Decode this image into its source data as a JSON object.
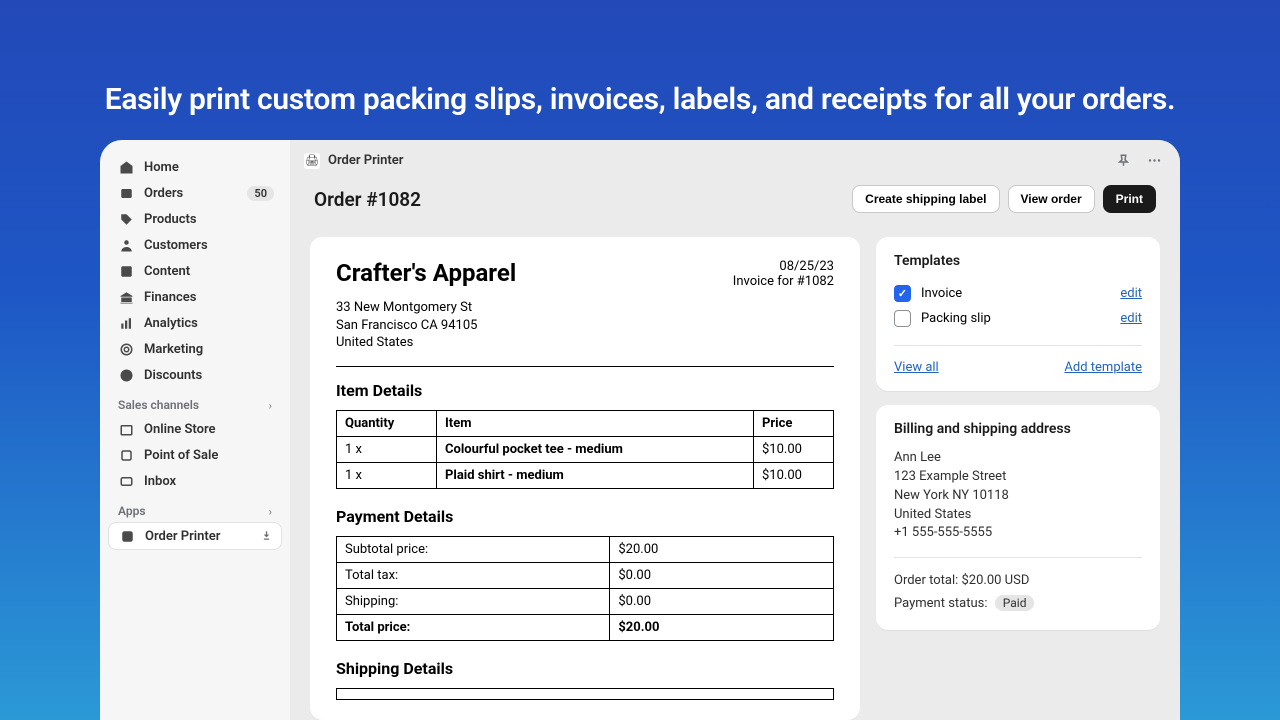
{
  "headline": "Easily print custom packing slips, invoices, labels, and receipts for all your orders.",
  "app_name": "Order Printer",
  "sidebar": {
    "items": [
      {
        "label": "Home"
      },
      {
        "label": "Orders",
        "badge": "50"
      },
      {
        "label": "Products"
      },
      {
        "label": "Customers"
      },
      {
        "label": "Content"
      },
      {
        "label": "Finances"
      },
      {
        "label": "Analytics"
      },
      {
        "label": "Marketing"
      },
      {
        "label": "Discounts"
      }
    ],
    "sales_channels_label": "Sales channels",
    "sales_channels": [
      {
        "label": "Online Store"
      },
      {
        "label": "Point of Sale"
      },
      {
        "label": "Inbox"
      }
    ],
    "apps_label": "Apps",
    "apps": [
      {
        "label": "Order Printer"
      }
    ]
  },
  "page": {
    "title": "Order #1082",
    "create_label_btn": "Create shipping label",
    "view_order_btn": "View order",
    "print_btn": "Print"
  },
  "invoice": {
    "company": "Crafter's Apparel",
    "date": "08/25/23",
    "subtitle": "Invoice for #1082",
    "address_line1": "33 New Montgomery St",
    "address_line2": "San Francisco CA 94105",
    "address_line3": "United States",
    "item_details_title": "Item Details",
    "headers": {
      "qty": "Quantity",
      "item": "Item",
      "price": "Price"
    },
    "items": [
      {
        "qty": "1 x",
        "name": "Colourful pocket tee - medium",
        "price": "$10.00"
      },
      {
        "qty": "1 x",
        "name": "Plaid shirt - medium",
        "price": "$10.00"
      }
    ],
    "payment_details_title": "Payment Details",
    "payment": [
      {
        "label": "Subtotal price:",
        "value": "$20.00"
      },
      {
        "label": "Total tax:",
        "value": "$0.00"
      },
      {
        "label": "Shipping:",
        "value": "$0.00"
      },
      {
        "label": "Total price:",
        "value": "$20.00",
        "total": true
      }
    ],
    "shipping_details_title": "Shipping Details"
  },
  "templates": {
    "title": "Templates",
    "rows": [
      {
        "name": "Invoice",
        "checked": true,
        "edit": "edit"
      },
      {
        "name": "Packing slip",
        "checked": false,
        "edit": "edit"
      }
    ],
    "view_all": "View all",
    "add": "Add template"
  },
  "billing": {
    "title": "Billing and shipping address",
    "name": "Ann Lee",
    "line1": "123 Example Street",
    "line2": "New York NY 10118",
    "line3": "United States",
    "phone": "+1 555-555-5555",
    "order_total_label": "Order total:",
    "order_total_value": "$20.00 USD",
    "payment_status_label": "Payment status:",
    "payment_status_value": "Paid"
  }
}
